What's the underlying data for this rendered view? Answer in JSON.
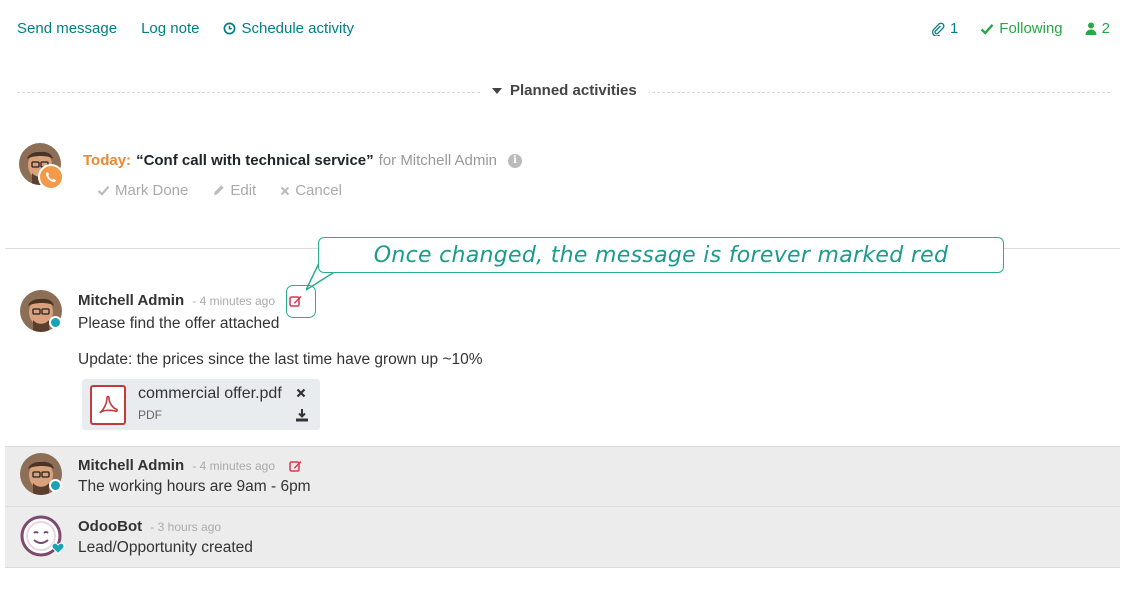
{
  "topbar": {
    "send_message": "Send message",
    "log_note": "Log note",
    "schedule_activity": "Schedule activity",
    "attachments_count": "1",
    "following": "Following",
    "followers_count": "2"
  },
  "activities": {
    "section_title": "Planned activities",
    "item": {
      "when": "Today:",
      "summary": "“Conf call with technical service”",
      "assigned": "for Mitchell Admin",
      "mark_done": "Mark Done",
      "edit": "Edit",
      "cancel": "Cancel"
    }
  },
  "callout": {
    "text": "Once changed, the message is forever marked red"
  },
  "messages": [
    {
      "author": "Mitchell Admin",
      "date": "- 4 minutes ago",
      "body_line1": "Please find the offer attached",
      "body_line2": "Update: the prices since the last time have grown up ~10%",
      "attachment": {
        "name": "commercial offer.pdf",
        "type": "PDF"
      }
    },
    {
      "author": "Mitchell Admin",
      "date": "- 4 minutes ago",
      "body": "The working hours are 9am - 6pm"
    },
    {
      "author": "OdooBot",
      "date": "- 3 hours ago",
      "body": "Lead/Opportunity created"
    }
  ],
  "colors": {
    "link": "#017e84",
    "following": "#28a745",
    "today": "#f0862e",
    "edited_marker": "#e0344e",
    "callout": "#27ae8c"
  }
}
